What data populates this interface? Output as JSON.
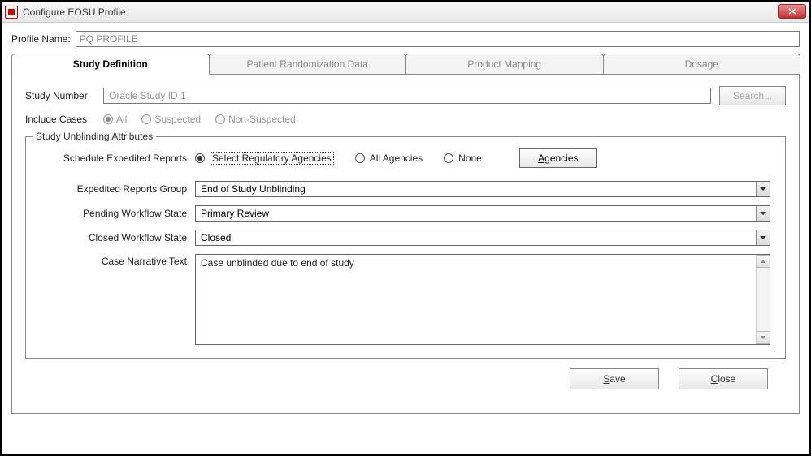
{
  "window": {
    "title": "Configure EOSU Profile"
  },
  "profile": {
    "label": "Profile Name:",
    "value": "PQ PROFILE"
  },
  "tabs": [
    {
      "label": "Study Definition",
      "active": true
    },
    {
      "label": "Patient Randomization Data",
      "active": false
    },
    {
      "label": "Product Mapping",
      "active": false
    },
    {
      "label": "Dosage",
      "active": false
    }
  ],
  "study": {
    "numberLabel": "Study Number",
    "numberValue": "Oracle Study ID 1",
    "searchBtn": "Search...",
    "includeLabel": "Include Cases",
    "includeOptions": {
      "all": "All",
      "suspected": "Suspected",
      "nonSuspected": "Non-Suspected"
    }
  },
  "unblind": {
    "legend": "Study Unblinding Attributes",
    "scheduleLabel": "Schedule Expedited Reports",
    "scheduleOptions": {
      "select": "Select Regulatory Agencies",
      "all": "All Agencies",
      "none": "None"
    },
    "agenciesBtnPrefix": "A",
    "agenciesBtnRest": "gencies",
    "groupLabel": "Expedited Reports Group",
    "groupValue": "End of Study Unblinding",
    "pendingLabel": "Pending Workflow State",
    "pendingValue": "Primary Review",
    "closedLabel": "Closed Workflow State",
    "closedValue": "Closed",
    "narrativeLabel": "Case Narrative Text",
    "narrativeValue": "Case unblinded due to end of study"
  },
  "footer": {
    "savePrefix": "S",
    "saveRest": "ave",
    "closePrefix": "C",
    "closeRest": "lose"
  }
}
